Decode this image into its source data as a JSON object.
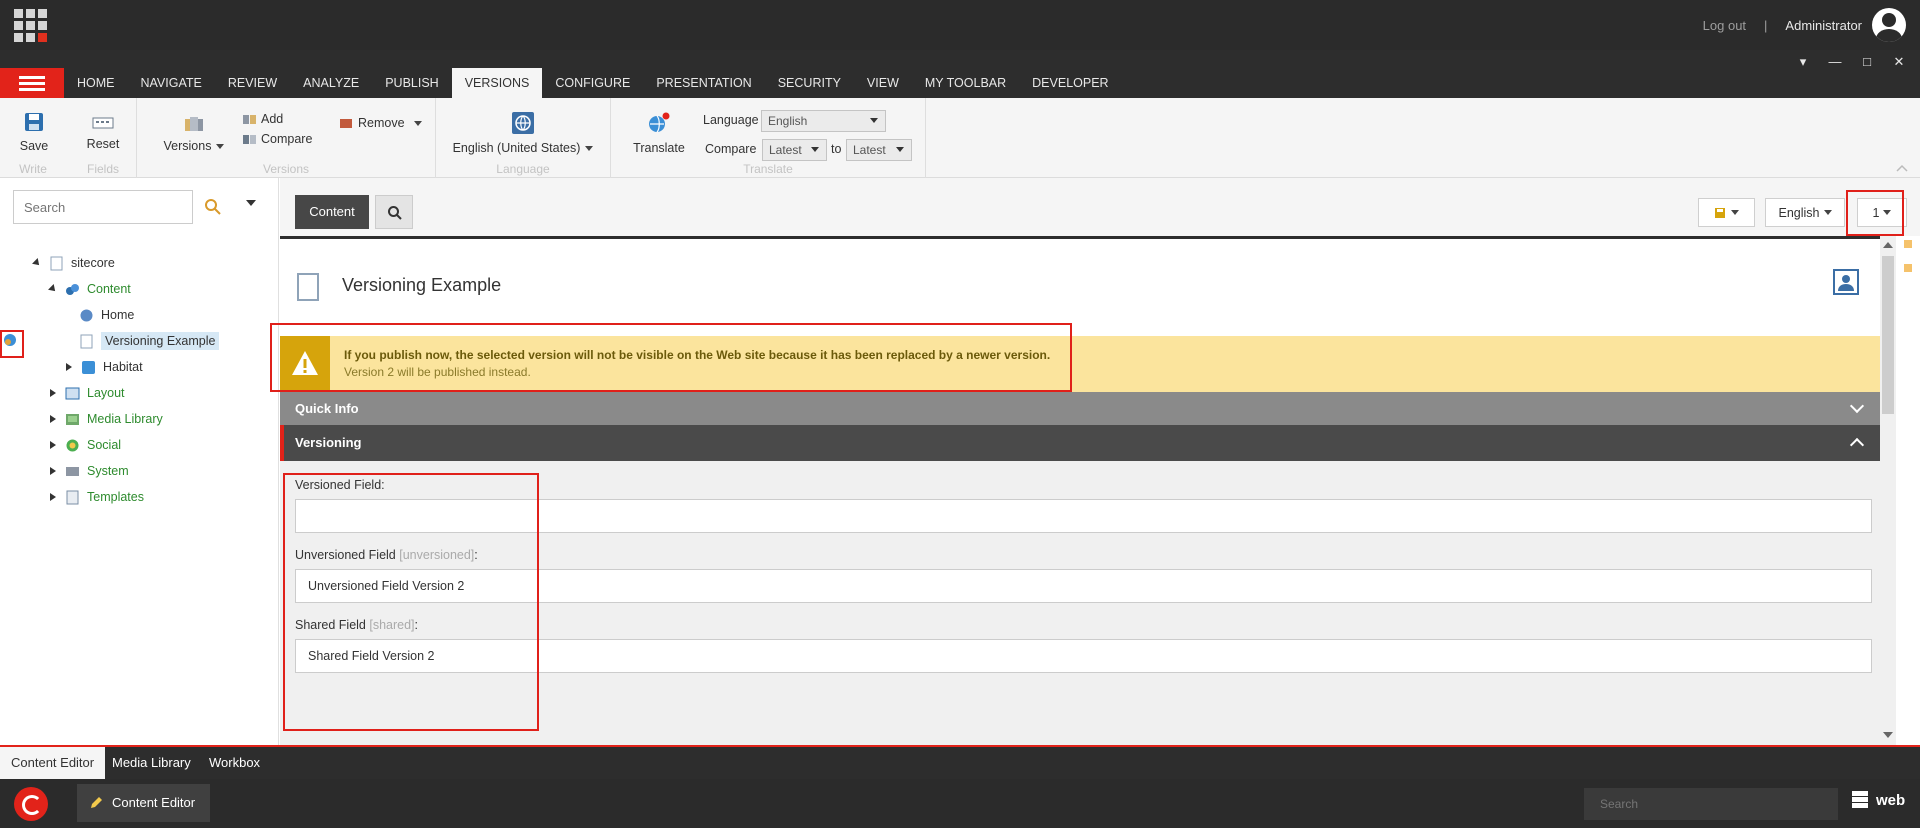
{
  "header": {
    "logout": "Log out",
    "separator": "|",
    "user": "Administrator"
  },
  "tabs": [
    "HOME",
    "NAVIGATE",
    "REVIEW",
    "ANALYZE",
    "PUBLISH",
    "VERSIONS",
    "CONFIGURE",
    "PRESENTATION",
    "SECURITY",
    "VIEW",
    "MY TOOLBAR",
    "DEVELOPER"
  ],
  "active_tab": "VERSIONS",
  "ribbon": {
    "write": {
      "save": "Save",
      "group": "Write"
    },
    "fields": {
      "reset": "Reset",
      "group": "Fields"
    },
    "versions": {
      "versions": "Versions",
      "add": "Add",
      "compare": "Compare",
      "remove": "Remove",
      "group": "Versions"
    },
    "language": {
      "current": "English (United States)",
      "group": "Language"
    },
    "translate": {
      "translate": "Translate",
      "language_label": "Language",
      "language_value": "English",
      "compare_label": "Compare",
      "compare_from": "Latest",
      "to_label": "to",
      "compare_to": "Latest",
      "group": "Translate"
    }
  },
  "left_panel": {
    "search_placeholder": "Search",
    "tree": {
      "sitecore": "sitecore",
      "content": "Content",
      "home": "Home",
      "versioning_example": "Versioning Example",
      "habitat": "Habitat",
      "layout": "Layout",
      "media_library": "Media Library",
      "social": "Social",
      "system": "System",
      "templates": "Templates"
    }
  },
  "main": {
    "content_tab": "Content",
    "language_button": "English",
    "version_button": "1",
    "item_title": "Versioning Example",
    "warning_line1": "If you publish now, the selected version will not be visible on the Web site because it has been replaced by a newer version.",
    "warning_line2": "Version 2 will be published instead.",
    "quick_info": "Quick Info",
    "versioning": "Versioning",
    "fields": {
      "versioned_label": "Versioned Field:",
      "versioned_value": "",
      "unversioned_label": "Unversioned Field",
      "unversioned_hint": "[unversioned]",
      "unversioned_value": "Unversioned Field Version 2",
      "shared_label": "Shared Field",
      "shared_hint": "[shared]",
      "shared_value": "Shared Field Version 2",
      "colon": ":"
    }
  },
  "bottom": {
    "tabs": [
      "Content Editor",
      "Media Library",
      "Workbox"
    ],
    "task_app": "Content Editor",
    "search_placeholder": "Search",
    "database": "web"
  },
  "colors": {
    "accent_red": "#e2231a",
    "warning_bg": "#fbe49d",
    "dark_header": "#2b2b2b"
  }
}
